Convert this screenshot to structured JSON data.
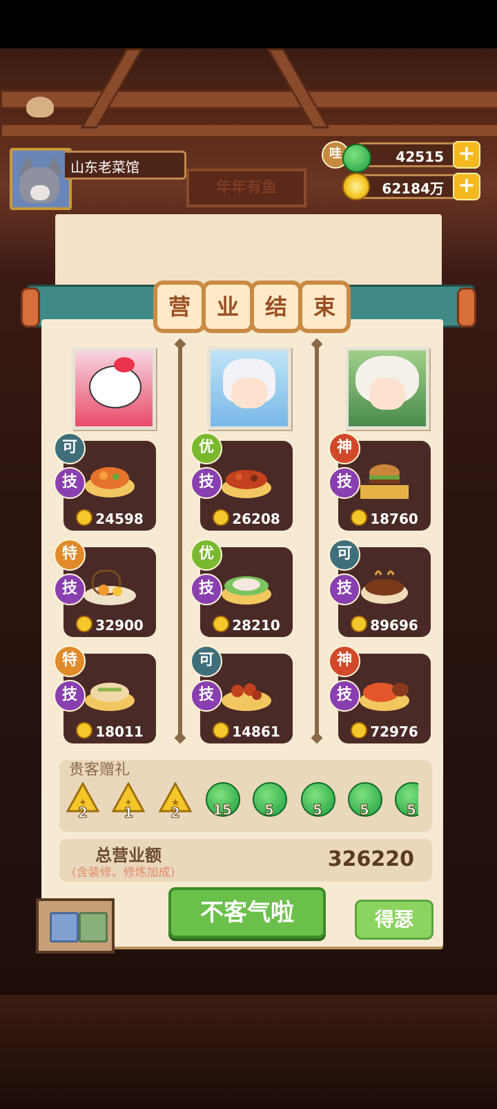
{
  "shop": {
    "name": "山东老菜馆",
    "sign": "年年有鱼"
  },
  "currency": {
    "gem_icon_label": "哇",
    "gems": "42515",
    "coins": "62184万"
  },
  "panel": {
    "title_chars": [
      "营",
      "业",
      "结",
      "束"
    ]
  },
  "guests": [
    {
      "portrait": "kitty-girl-avatar",
      "dishes": [
        {
          "rank": "可",
          "rank_color": "#3f6f7a",
          "skill": "技",
          "price": "24598"
        },
        {
          "rank": "特",
          "rank_color": "#e08a2a",
          "skill": "技",
          "price": "32900"
        },
        {
          "rank": "特",
          "rank_color": "#e08a2a",
          "skill": "技",
          "price": "18011"
        }
      ]
    },
    {
      "portrait": "white-hair-boy-avatar",
      "dishes": [
        {
          "rank": "优",
          "rank_color": "#7ab82e",
          "skill": "技",
          "price": "26208"
        },
        {
          "rank": "优",
          "rank_color": "#7ab82e",
          "skill": "技",
          "price": "28210"
        },
        {
          "rank": "可",
          "rank_color": "#3f6f7a",
          "skill": "技",
          "price": "14861"
        }
      ]
    },
    {
      "portrait": "curly-hair-girl-avatar",
      "dishes": [
        {
          "rank": "神",
          "rank_color": "#d1492a",
          "skill": "技",
          "price": "18760"
        },
        {
          "rank": "可",
          "rank_color": "#3f6f7a",
          "skill": "技",
          "price": "89696"
        },
        {
          "rank": "神",
          "rank_color": "#d1492a",
          "skill": "技",
          "price": "72976"
        }
      ]
    }
  ],
  "gifts": {
    "label": "贵客赠礼",
    "items": [
      {
        "type": "gold-seal",
        "count": "2"
      },
      {
        "type": "gold-seal",
        "count": "1"
      },
      {
        "type": "gold-seal",
        "count": "2"
      },
      {
        "type": "green-gem",
        "count": "15"
      },
      {
        "type": "green-gem",
        "count": "5"
      },
      {
        "type": "green-gem",
        "count": "5"
      },
      {
        "type": "green-gem",
        "count": "5"
      },
      {
        "type": "green-gem",
        "count": "5"
      }
    ]
  },
  "total": {
    "label": "总营业额",
    "sublabel": "(含装修、修炼加成)",
    "value": "326220"
  },
  "buttons": {
    "confirm": "不客气啦",
    "boast": "得瑟"
  }
}
